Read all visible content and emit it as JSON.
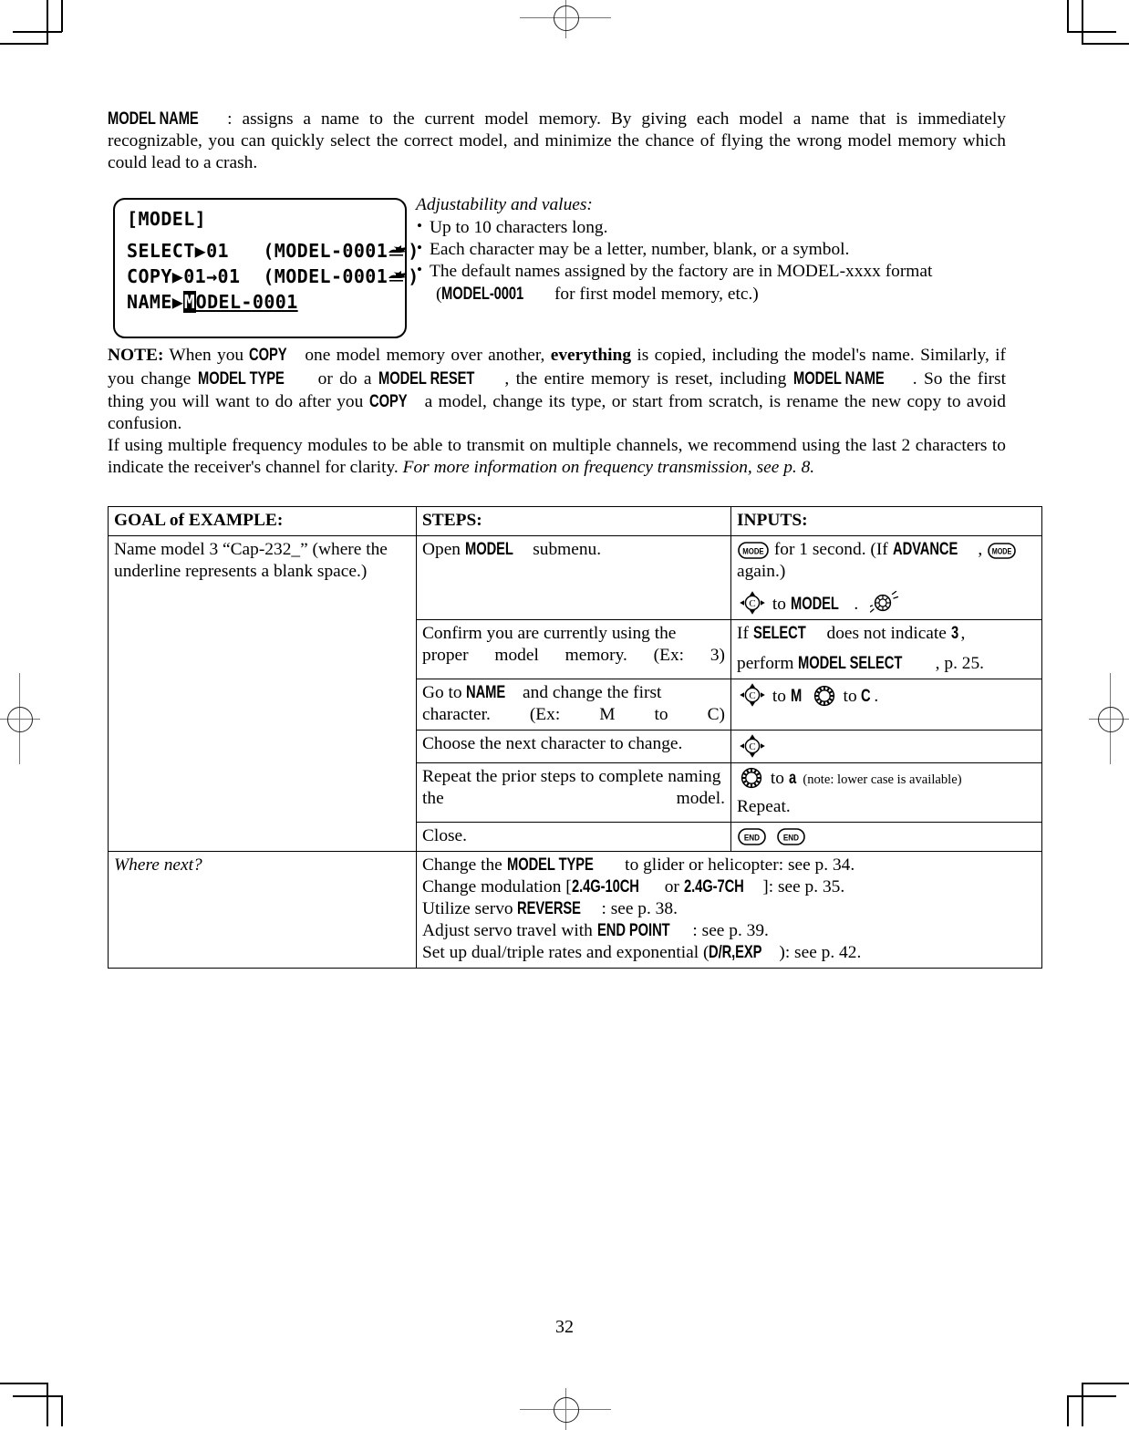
{
  "page": {
    "number": "32"
  },
  "intro": {
    "term": "MODEL NAME",
    "text": ": assigns a name to the current model memory. By giving each model a name that is immediately recognizable, you can quickly select the correct model, and minimize the chance of flying the wrong model memory which could lead to a crash."
  },
  "lcd": {
    "title": "[MODEL]",
    "line_select_label": "SELECT",
    "line_select_value": "01",
    "line_select_paren_open": "(MODEL-0001",
    "line_select_paren_close": ")",
    "line_copy_label": "COPY",
    "line_copy_value": "01→01",
    "line_copy_paren_open": "(MODEL-0001",
    "line_copy_paren_close": ")",
    "line_name_label": "NAME",
    "line_name_cursor_char": "M",
    "line_name_rest": "ODEL-0001",
    "arrow": "▶"
  },
  "adjustability": {
    "heading": "Adjustability and values:",
    "items": [
      "Up to 10 characters long.",
      "Each character may be a letter, number, blank, or a symbol.",
      "The default names assigned by the factory are in MODEL-xxxx format"
    ],
    "item3_line2_prefix": "(",
    "item3_line2_bold": "MODEL-0001",
    "item3_line2_suffix": " for first model memory, etc.)"
  },
  "note": {
    "label": "NOTE:",
    "t1": " When you ",
    "b1": "COPY",
    "t2": " one model memory over another, ",
    "bold_everything": "everything",
    "t3": " is copied, including the model's name. Similarly, if you change ",
    "b2": "MODEL TYPE",
    "t4": " or do a ",
    "b3": "MODEL RESET",
    "t5": ", the entire memory is reset, including ",
    "b4": "MODEL NAME",
    "t6": ". So the first thing you will want to do after you ",
    "b5": "COPY",
    "t7": " a model, change its type, or start from scratch, is rename the new copy to avoid confusion.",
    "p2a": "If using multiple frequency modules to be able to transmit on multiple channels, we recommend using the last 2 characters to indicate the receiver's channel for clarity. ",
    "p2_italic": "For more information on frequency transmission, see p. 8."
  },
  "table": {
    "headers": {
      "goal": "GOAL of EXAMPLE:",
      "steps": "STEPS:",
      "inputs": "INPUTS:"
    },
    "goal_text": "Name model 3 “Cap-232_” (where the underline represents a blank space.)",
    "rows": [
      {
        "step_pre": "Open ",
        "step_bold": "MODEL",
        "step_post": " submenu.",
        "input_line1": {
          "icon1": "mode-button-icon",
          "t1": " for 1 second. (If ",
          "b1": "ADVANCE",
          "t2": ", ",
          "icon2": "mode-button-icon",
          "t3": " again.)"
        },
        "input_line2": {
          "icon1": "cursor-pad-icon",
          "t1": " to ",
          "b1": "MODEL",
          "t2": ".",
          "icon2": "dial-spin-icon"
        }
      },
      {
        "step_plain": "Confirm you are currently using the proper model memory. (Ex: 3)",
        "input_l1_pre": "If ",
        "input_l1_bold": "SELECT",
        "input_l1_mid": " does not indicate ",
        "input_l1_bold2": "3",
        "input_l1_post": ",",
        "input_l2_pre": "perform ",
        "input_l2_bold": "MODEL SELECT",
        "input_l2_post": ", p. 25."
      },
      {
        "step_pre": "Go to ",
        "step_bold": "NAME",
        "step_post": " and change the first character. (Ex: M to C)",
        "input_t1": " to ",
        "input_b1": "M",
        "input_t2": " to ",
        "input_b2": "C",
        "input_t3": "."
      },
      {
        "step_plain": "Choose the next character to change.",
        "input_icon": "cursor-pad-icon"
      },
      {
        "step_plain": "Repeat the prior steps to complete naming the model.",
        "input_t1": " to ",
        "input_b1": "a",
        "input_note": "(note: lower case is available)",
        "input_line2": "Repeat."
      },
      {
        "step_plain": "Close.",
        "input_icon1": "end-button-icon",
        "input_icon2": "end-button-icon"
      }
    ],
    "where_next": {
      "label": "Where next?",
      "lines": [
        {
          "pre": "Change the ",
          "bold": "MODEL TYPE",
          "post": " to glider or helicopter: see p. 34."
        },
        {
          "pre": "Change modulation [",
          "bold": "2.4G-10CH",
          "mid": " or ",
          "bold2": "2.4G-7CH",
          "post": "]: see p. 35."
        },
        {
          "pre": "Utilize servo ",
          "bold": "REVERSE",
          "post": ": see p. 38."
        },
        {
          "pre": "Adjust servo travel with ",
          "bold": "END POINT",
          "post": ": see p. 39."
        },
        {
          "pre": "Set up dual/triple rates and exponential (",
          "bold": "D/R,EXP",
          "post": "): see p. 42."
        }
      ]
    }
  },
  "icons": {
    "mode_label": "MODE",
    "end_label": "END",
    "cursor_label": "C"
  }
}
